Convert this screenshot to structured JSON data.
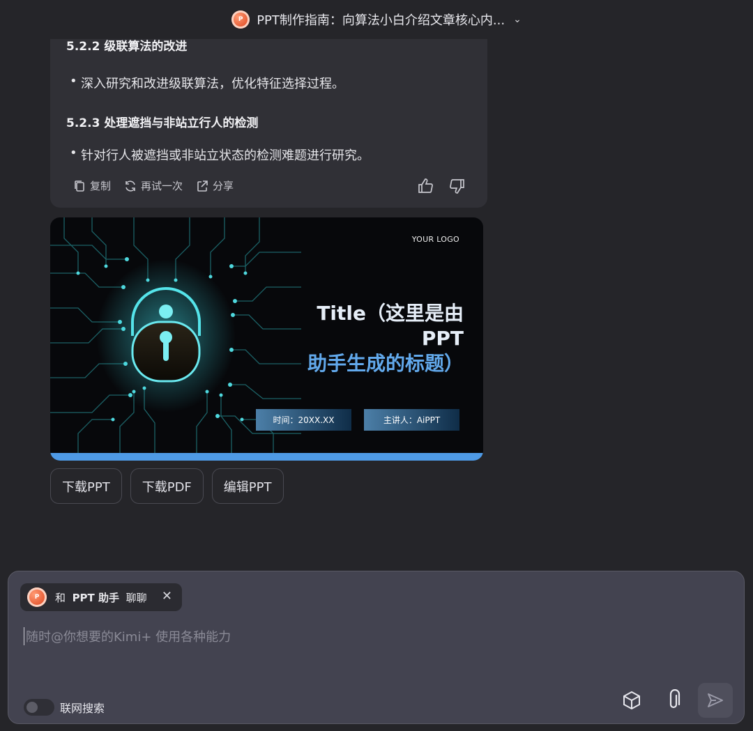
{
  "header": {
    "title": "PPT制作指南：向算法小白介绍文章核心内...",
    "logo_letter": "P"
  },
  "message": {
    "cut_heading": "5.2.2 级联算法的改进",
    "bullet1": "深入研究和改进级联算法，优化特征选择过程。",
    "heading2": "5.2.3 处理遮挡与非站立行人的检测",
    "bullet2": "针对行人被遮挡或非站立状态的检测难题进行研究。",
    "actions": {
      "copy": "复制",
      "retry": "再试一次",
      "share": "分享"
    }
  },
  "slide": {
    "logo_text": "YOUR LOGO",
    "title_line1": "Title（这里是由PPT",
    "title_line2": "助手生成的标题）",
    "time_tag": "时间：20XX.XX",
    "speaker_tag": "主讲人：AiPPT",
    "accent": "#4e9ae6"
  },
  "buttons": {
    "download_ppt": "下载PPT",
    "download_pdf": "下载PDF",
    "edit_ppt": "编辑PPT"
  },
  "composer": {
    "chip_prefix": "和",
    "chip_name": "PPT 助手",
    "chip_suffix": "聊聊",
    "placeholder": "随时@你想要的Kimi+ 使用各种能力",
    "web_search_label": "联网搜索",
    "web_search_enabled": false
  }
}
